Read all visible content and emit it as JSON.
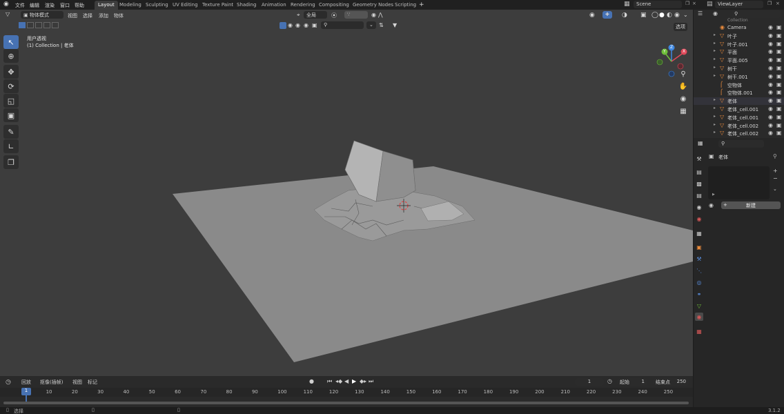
{
  "menu": {
    "items": [
      "文件",
      "编辑",
      "渲染",
      "窗口",
      "帮助"
    ]
  },
  "workspaces": [
    {
      "label": "Layout",
      "active": true
    },
    {
      "label": "Modeling",
      "active": false
    },
    {
      "label": "Sculpting",
      "active": false
    },
    {
      "label": "UV Editing",
      "active": false
    },
    {
      "label": "Texture Paint",
      "active": false
    },
    {
      "label": "Shading",
      "active": false
    },
    {
      "label": "Animation",
      "active": false
    },
    {
      "label": "Rendering",
      "active": false
    },
    {
      "label": "Compositing",
      "active": false
    },
    {
      "label": "Geometry Nodes",
      "active": false
    },
    {
      "label": "Scripting",
      "active": false
    }
  ],
  "add_workspace": "+",
  "scene": {
    "value": "Scene"
  },
  "view_layer": {
    "value": "ViewLayer"
  },
  "viewport_header": {
    "mode": "物体模式",
    "menus": [
      "视图",
      "选择",
      "添加",
      "物体"
    ],
    "orientation": "全局",
    "options": "选项"
  },
  "viewport_info": {
    "view_name": "用户透视",
    "collection": "(1) Collection | 老体"
  },
  "gizmo": {
    "x": "X",
    "y": "Y",
    "z": "Z"
  },
  "outliner": {
    "header": "Collection",
    "rows": [
      {
        "name": "Camera",
        "icon": "camera-icon"
      },
      {
        "name": "叶子",
        "icon": "mesh-icon"
      },
      {
        "name": "叶子.001",
        "icon": "mesh-icon"
      },
      {
        "name": "平面",
        "icon": "mesh-icon"
      },
      {
        "name": "平面.005",
        "icon": "mesh-icon"
      },
      {
        "name": "树干",
        "icon": "mesh-icon"
      },
      {
        "name": "树干.001",
        "icon": "mesh-icon"
      },
      {
        "name": "空物体",
        "icon": "empty-icon"
      },
      {
        "name": "空物体.001",
        "icon": "empty-icon"
      },
      {
        "name": "老体",
        "icon": "mesh-icon"
      },
      {
        "name": "老体_cell.001",
        "icon": "mesh-icon"
      },
      {
        "name": "老体_cell.001",
        "icon": "mesh-icon"
      },
      {
        "name": "老体_cell.002",
        "icon": "mesh-icon"
      },
      {
        "name": "老体_cell.002",
        "icon": "mesh-icon"
      }
    ]
  },
  "properties": {
    "object_name": "老体",
    "new_button": "新建"
  },
  "timeline": {
    "menus": [
      "回放",
      "抠像(插帧)",
      "视图",
      "标记"
    ],
    "current_frame": "1",
    "start_label": "起始",
    "start_value": "1",
    "end_label": "结束点",
    "end_value": "250",
    "ticks": [
      "10",
      "20",
      "30",
      "40",
      "50",
      "60",
      "70",
      "80",
      "90",
      "100",
      "110",
      "120",
      "130",
      "140",
      "150",
      "160",
      "170",
      "180",
      "190",
      "200",
      "210",
      "220",
      "230",
      "240",
      "250"
    ],
    "playhead": "1"
  },
  "statusbar": {
    "select": "选择",
    "version": "3.1.2"
  },
  "colors": {
    "accent": "#4772b3",
    "mesh_orange": "#e88a3c",
    "x_axis": "#e0495a",
    "y_axis": "#6fbf3a",
    "z_axis": "#3f88e0"
  }
}
